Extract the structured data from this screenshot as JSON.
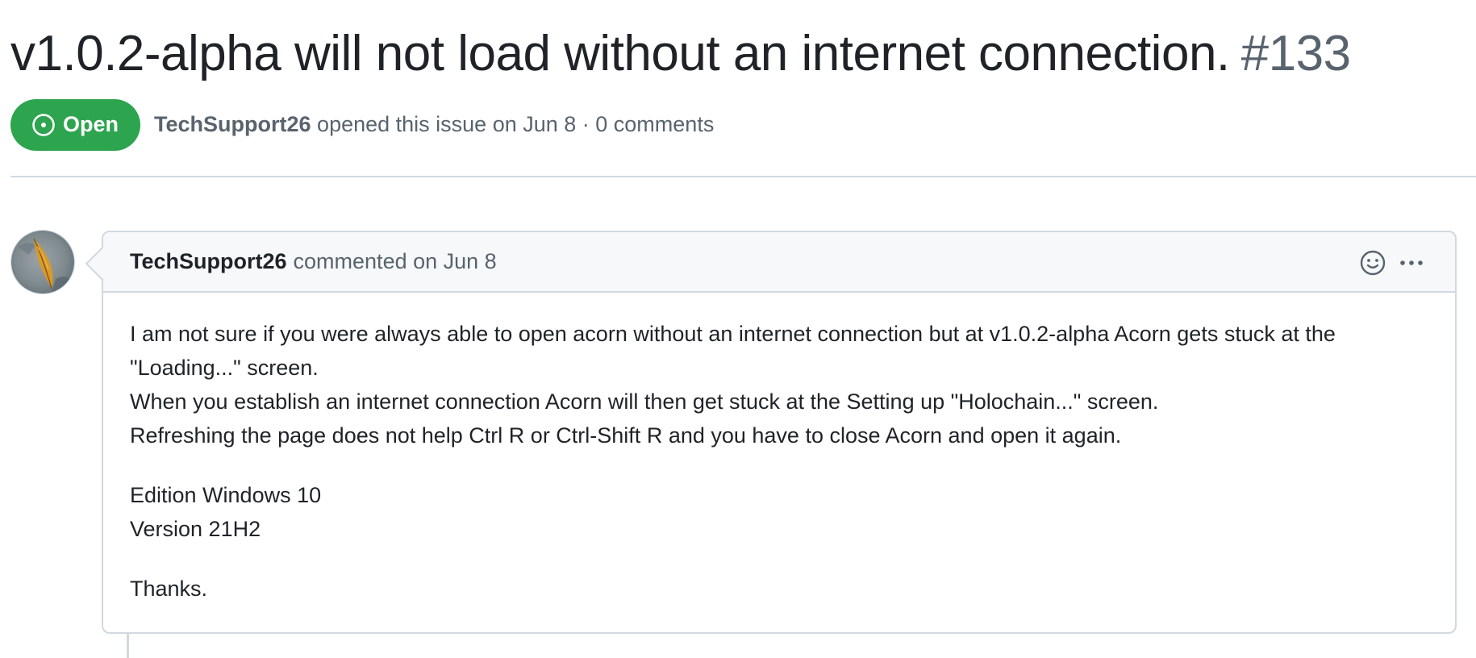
{
  "issue": {
    "title": "v1.0.2-alpha will not load without an internet connection.",
    "number": "#133",
    "state": "Open",
    "author": "TechSupport26",
    "opened_text": " opened this issue on Jun 8 · 0 comments"
  },
  "comment": {
    "author": "TechSupport26",
    "action": "commented on Jun 8",
    "body": {
      "line1": "I am not sure if you were always able to open acorn without an internet connection but at v1.0.2-alpha Acorn gets stuck at the \"Loading...\" screen.",
      "line2": "When you establish an internet connection Acorn will then get stuck at the Setting up \"Holochain...\" screen.",
      "line3": "Refreshing the page does not help Ctrl R or Ctrl-Shift R and you have to close Acorn and open it again.",
      "edition": "Edition Windows 10",
      "version": "Version 21H2",
      "thanks": "Thanks."
    }
  },
  "icons": {
    "state": "issue-open-icon",
    "reaction": "smiley-icon",
    "menu": "kebab-horizontal-icon"
  },
  "colors": {
    "open_badge": "#2da44e",
    "muted_text": "#59636e",
    "border": "#d1d9e0",
    "header_bg": "#f6f8fa"
  }
}
